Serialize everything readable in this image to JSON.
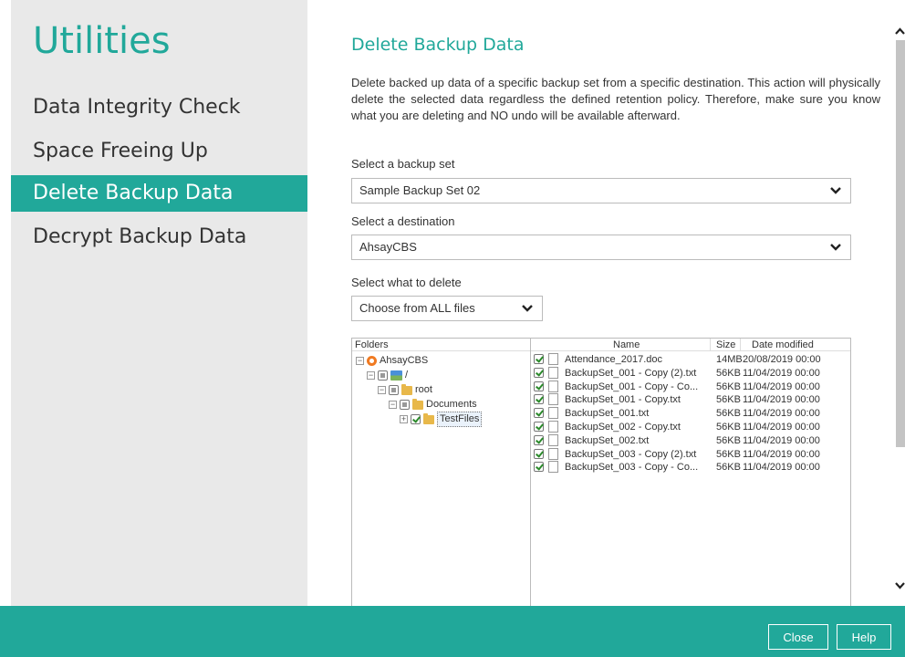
{
  "sidebar": {
    "title": "Utilities",
    "items": [
      {
        "label": "Data Integrity Check"
      },
      {
        "label": "Space Freeing Up"
      },
      {
        "label": "Delete Backup Data"
      },
      {
        "label": "Decrypt Backup Data"
      }
    ],
    "active_index": 2
  },
  "main": {
    "heading": "Delete Backup Data",
    "description": "Delete backed up data of a specific backup set from a specific destination. This action will physically delete the selected data regardless the defined retention policy. Therefore, make sure you know what you are deleting and NO undo will be available afterward.",
    "backup_set": {
      "label": "Select a backup set",
      "value": "Sample Backup Set 02"
    },
    "destination": {
      "label": "Select a destination",
      "value": "AhsayCBS"
    },
    "what_to_delete": {
      "label": "Select what to delete",
      "value": "Choose from ALL files"
    }
  },
  "tree": {
    "header": "Folders",
    "nodes": [
      {
        "label": "AhsayCBS",
        "icon": "ahsay-icon",
        "expander": "−",
        "checkbox": "none"
      },
      {
        "label": "/",
        "icon": "drive-icon",
        "expander": "−",
        "checkbox": "partial"
      },
      {
        "label": "root",
        "icon": "folder-icon",
        "expander": "−",
        "checkbox": "partial"
      },
      {
        "label": "Documents",
        "icon": "folder-icon",
        "expander": "−",
        "checkbox": "partial"
      },
      {
        "label": "TestFiles",
        "icon": "folder-icon",
        "expander": "+",
        "checkbox": "checked"
      }
    ]
  },
  "file_list": {
    "headers": {
      "name": "Name",
      "size": "Size",
      "date": "Date modified"
    },
    "rows": [
      {
        "name": "Attendance_2017.doc",
        "size": "14MB",
        "date": "20/08/2019 00:00",
        "checked": true
      },
      {
        "name": "BackupSet_001 - Copy (2).txt",
        "size": "56KB",
        "date": "11/04/2019 00:00",
        "checked": true
      },
      {
        "name": "BackupSet_001 - Copy - Co...",
        "size": "56KB",
        "date": "11/04/2019 00:00",
        "checked": true
      },
      {
        "name": "BackupSet_001 - Copy.txt",
        "size": "56KB",
        "date": "11/04/2019 00:00",
        "checked": true
      },
      {
        "name": "BackupSet_001.txt",
        "size": "56KB",
        "date": "11/04/2019 00:00",
        "checked": true
      },
      {
        "name": "BackupSet_002 - Copy.txt",
        "size": "56KB",
        "date": "11/04/2019 00:00",
        "checked": true
      },
      {
        "name": "BackupSet_002.txt",
        "size": "56KB",
        "date": "11/04/2019 00:00",
        "checked": true
      },
      {
        "name": "BackupSet_003 - Copy (2).txt",
        "size": "56KB",
        "date": "11/04/2019 00:00",
        "checked": true
      },
      {
        "name": "BackupSet_003 - Copy - Co...",
        "size": "56KB",
        "date": "11/04/2019 00:00",
        "checked": true
      }
    ]
  },
  "footer": {
    "close_label": "Close",
    "help_label": "Help"
  },
  "colors": {
    "accent": "#21a89a",
    "sidebar_bg": "#e9e9e9"
  }
}
